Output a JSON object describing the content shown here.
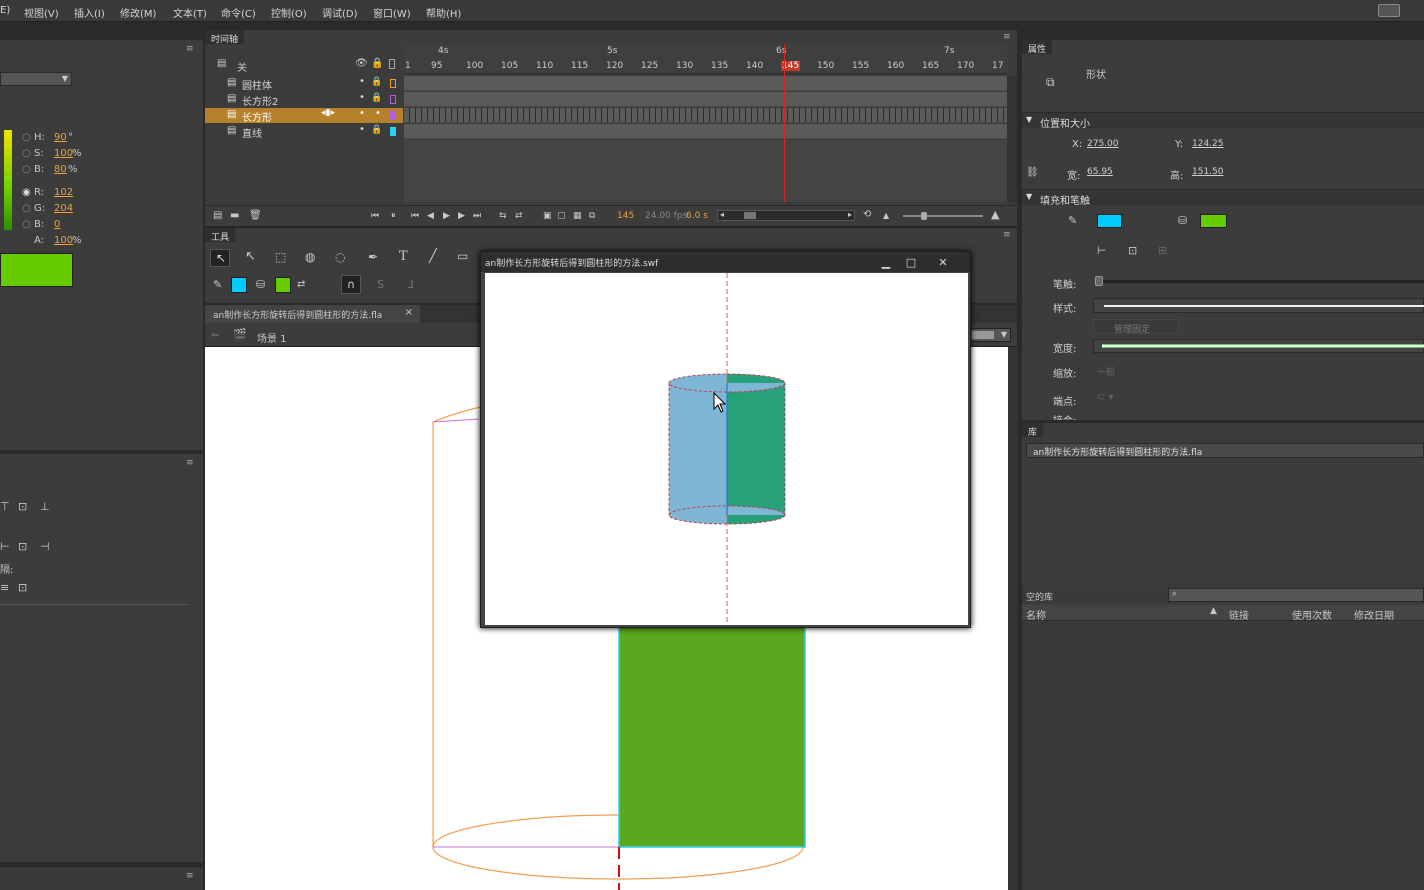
{
  "menu": [
    "E)",
    "视图(V)",
    "插入(I)",
    "修改(M)",
    "文本(T)",
    "命令(C)",
    "控制(O)",
    "调试(D)",
    "窗口(W)",
    "帮助(H)"
  ],
  "timeline": {
    "tab": "时间轴",
    "header_label": "关",
    "seconds": [
      "4s",
      "5s",
      "6s",
      "7s"
    ],
    "ticks": [
      "1",
      "95",
      "100",
      "105",
      "110",
      "115",
      "120",
      "125",
      "130",
      "135",
      "140",
      "145",
      "150",
      "155",
      "160",
      "165",
      "170",
      "17"
    ],
    "layers": [
      {
        "name": "圆柱体",
        "color": "#f59a25",
        "selected": false
      },
      {
        "name": "长方形2",
        "color": "#b060e0",
        "selected": false
      },
      {
        "name": "长方形",
        "color": "#b060e0",
        "selected": true
      },
      {
        "name": "直线",
        "color": "#26d2f5",
        "selected": false
      }
    ],
    "current_frame": "145",
    "fps": "24.00 fps",
    "time": "6.0 s"
  },
  "color_panel": {
    "h_label": "H:",
    "h_value": "90",
    "h_unit": "°",
    "s_label": "S:",
    "s_value": "100",
    "s_unit": "%",
    "b_label": "B:",
    "b_value": "80",
    "b_unit": "%",
    "r_label": "R:",
    "r_value": "102",
    "g_label": "G:",
    "g_value": "204",
    "bb_label": "B:",
    "bb_value": "0",
    "a_label": "A:",
    "a_value": "100",
    "a_unit": "%",
    "swatch_color": "#66cc00"
  },
  "align_panel": {
    "spacing_label": "隔:"
  },
  "tools": {
    "tab": "工具",
    "stroke_color": "#00ccff",
    "fill_color": "#66cc00"
  },
  "document": {
    "tab": "an制作长方形旋转后得到圆柱形的方法.fla",
    "tab_close": "×",
    "scene": "场景 1"
  },
  "swf_window": {
    "title": "an制作长方形旋转后得到圆柱形的方法.swf",
    "min": "▁",
    "max": "□",
    "close": "✕"
  },
  "properties": {
    "tab": "属性",
    "type": "形状",
    "section_pos": "位置和大小",
    "x_label": "X:",
    "x_value": "275.00",
    "y_label": "Y:",
    "y_value": "124.25",
    "w_label": "宽:",
    "w_value": "65.95",
    "h_label": "高:",
    "h_value": "151.50",
    "section_fill": "填充和笔触",
    "stroke_color": "#00ccff",
    "fill_color": "#66cc00",
    "stroke_label": "笔触:",
    "style_label": "样式:",
    "manage_label": "管理固定",
    "width_label": "宽度:",
    "scale_label": "缩放:",
    "scale_value": "一般",
    "cap_label": "端点:",
    "join_label": "接合:"
  },
  "library": {
    "tab": "库",
    "file": "an制作长方形旋转后得到圆柱形的方法.fla",
    "empty": "空的库",
    "cols": [
      "名称",
      "链接",
      "使用次数",
      "修改日期"
    ]
  }
}
